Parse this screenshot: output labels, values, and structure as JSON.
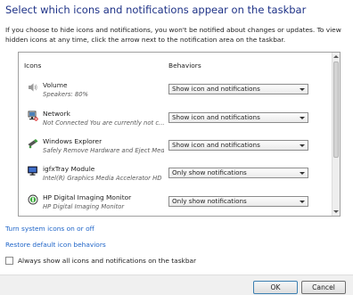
{
  "title": "Select which icons and notifications appear on the taskbar",
  "description": "If you choose to hide icons and notifications, you won't be notified about changes or updates. To view hidden icons at any time, click the arrow next to the notification area on the taskbar.",
  "table": {
    "col_icons": "Icons",
    "col_behaviors": "Behaviors",
    "rows": [
      {
        "name": "Volume",
        "sub": "Speakers: 80%",
        "behavior": "Show icon and notifications",
        "icon": "speaker-icon"
      },
      {
        "name": "Network",
        "sub": "Not Connected You are currently not c...",
        "behavior": "Show icon and notifications",
        "icon": "network-icon"
      },
      {
        "name": "Windows Explorer",
        "sub": "Safely Remove Hardware and Eject Med...",
        "behavior": "Show icon and notifications",
        "icon": "usb-icon"
      },
      {
        "name": "igfxTray Module",
        "sub": "Intel(R) Graphics Media Accelerator HD",
        "behavior": "Only show notifications",
        "icon": "monitor-icon"
      },
      {
        "name": "HP Digital Imaging Monitor",
        "sub": "HP Digital Imaging Monitor",
        "behavior": "Only show notifications",
        "icon": "hp-icon"
      }
    ]
  },
  "links": {
    "system_icons": "Turn system icons on or off",
    "restore_default": "Restore default icon behaviors"
  },
  "checkbox": {
    "label": "Always show all icons and notifications on the taskbar",
    "checked": false
  },
  "buttons": {
    "ok": "OK",
    "cancel": "Cancel"
  },
  "colors": {
    "title": "#1e3287",
    "link": "#1e64c8"
  }
}
